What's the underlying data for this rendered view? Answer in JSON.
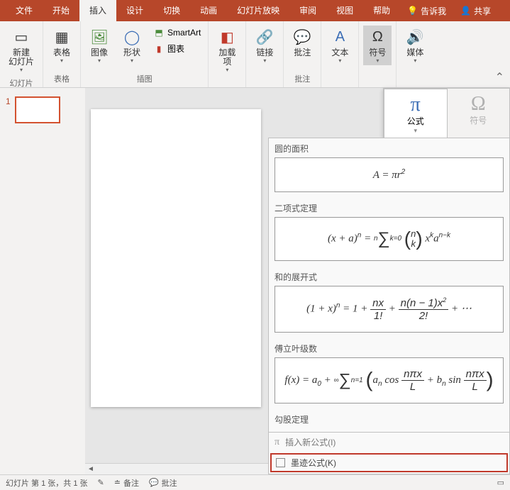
{
  "menu": {
    "file": "文件",
    "home": "开始",
    "insert": "插入",
    "design": "设计",
    "transition": "切换",
    "animation": "动画",
    "slideshow": "幻灯片放映",
    "review": "审阅",
    "view": "视图",
    "help": "帮助",
    "tellme": "告诉我",
    "share": "共享"
  },
  "ribbon": {
    "newslide": "新建\n幻灯片",
    "table": "表格",
    "image": "图像",
    "shapes": "形状",
    "smartart": "SmartArt",
    "chart": "图表",
    "addin": "加载\n项",
    "link": "链接",
    "comment": "批注",
    "text": "文本",
    "symbol": "符号",
    "media": "媒体",
    "grp_slides": "幻灯片",
    "grp_tables": "表格",
    "grp_illust": "插图",
    "grp_comments": "批注"
  },
  "thumb": {
    "num": "1"
  },
  "symmenu": {
    "equation": "公式",
    "symbol": "符号"
  },
  "eq": {
    "circle": {
      "title": "圆的面积"
    },
    "binom": {
      "title": "二项式定理"
    },
    "sum_expand": {
      "title": "和的展开式"
    },
    "fourier": {
      "title": "傅立叶级数"
    },
    "pythag": {
      "title": "勾股定理"
    },
    "insert_new": "插入新公式(I)",
    "ink": "墨迹公式(K)"
  },
  "status": {
    "slide": "幻灯片 第 1 张，共 1 张",
    "notes": "备注",
    "comments": "批注"
  },
  "chart_data": null
}
